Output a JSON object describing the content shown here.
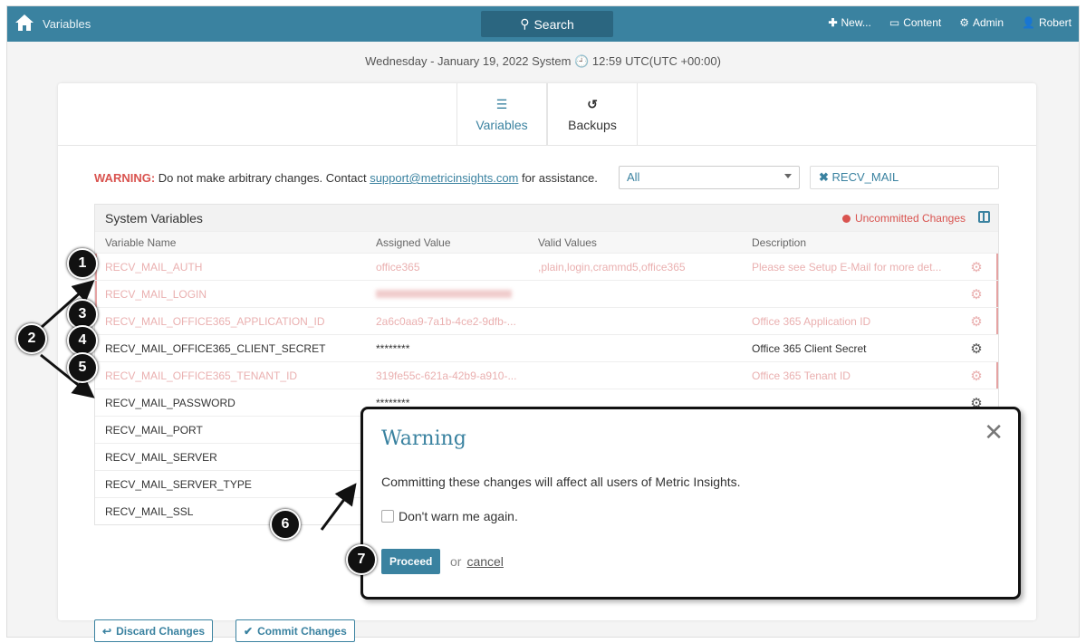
{
  "topbar": {
    "title": "Variables",
    "search": "Search",
    "new": "New...",
    "content": "Content",
    "admin": "Admin",
    "user": "Robert"
  },
  "date": "Wednesday - January 19, 2022 System",
  "time": "12:59 UTC(UTC +00:00)",
  "tabs": [
    {
      "label": "Variables"
    },
    {
      "label": "Backups"
    }
  ],
  "warning": {
    "label": "WARNING:",
    "text1": " Do not make arbitrary changes. Contact ",
    "email": "support@metricinsights.com",
    "text2": " for assistance."
  },
  "filter": {
    "select": "All",
    "search": "RECV_MAIL"
  },
  "table": {
    "title": "System Variables",
    "uncommitted": "Uncommitted Changes",
    "headers": [
      "Variable Name",
      "Assigned Value",
      "Valid Values",
      "Description"
    ],
    "rows": [
      {
        "name": "RECV_MAIL_AUTH",
        "value": "office365",
        "valid": ",plain,login,crammd5,office365",
        "desc": "Please see Setup E-Mail  for more det..."
      },
      {
        "name": "RECV_MAIL_LOGIN",
        "value": "",
        "valid": "",
        "desc": ""
      },
      {
        "name": "RECV_MAIL_OFFICE365_APPLICATION_ID",
        "value": "2a6c0aa9-7a1b-4ce2-9dfb-...",
        "valid": "",
        "desc": "Office 365 Application ID"
      },
      {
        "name": "RECV_MAIL_OFFICE365_CLIENT_SECRET",
        "value": "********",
        "valid": "",
        "desc": "Office 365 Client Secret"
      },
      {
        "name": "RECV_MAIL_OFFICE365_TENANT_ID",
        "value": "319fe55c-621a-42b9-a910-...",
        "valid": "",
        "desc": "Office 365 Tenant ID"
      },
      {
        "name": "RECV_MAIL_PASSWORD",
        "value": "********",
        "valid": "",
        "desc": ""
      },
      {
        "name": "RECV_MAIL_PORT",
        "value": "",
        "valid": "",
        "desc": ""
      },
      {
        "name": "RECV_MAIL_SERVER",
        "value": "",
        "valid": "",
        "desc": ""
      },
      {
        "name": "RECV_MAIL_SERVER_TYPE",
        "value": "",
        "valid": "",
        "desc": ""
      },
      {
        "name": "RECV_MAIL_SSL",
        "value": "",
        "valid": "",
        "desc": ""
      }
    ]
  },
  "buttons": {
    "discard": "Discard Changes",
    "commit": "Commit Changes"
  },
  "modal": {
    "title": "Warning",
    "body": "Committing these changes will affect all users of Metric Insights.",
    "checkbox": "Don't warn me again.",
    "proceed": "Proceed",
    "or": "or",
    "cancel": "cancel"
  },
  "annotations": [
    "1",
    "2",
    "3",
    "4",
    "5",
    "6",
    "7"
  ]
}
